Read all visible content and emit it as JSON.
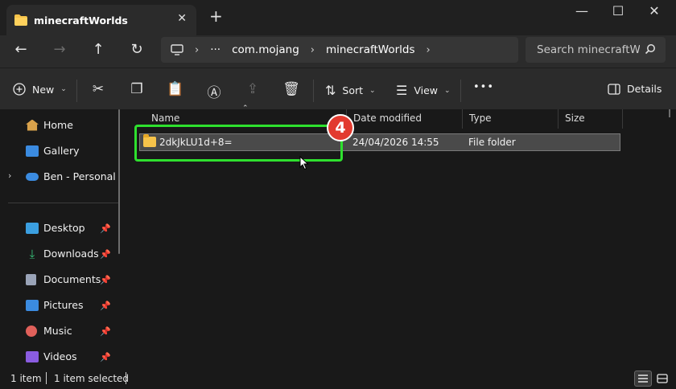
{
  "window": {
    "tab_title": "minecraftWorlds",
    "new_tab_symbol": "+",
    "close_tab_symbol": "✕",
    "minimize_symbol": "—",
    "maximize_symbol": "☐",
    "close_symbol": "✕"
  },
  "address": {
    "ellipsis": "···",
    "crumbs": [
      "com.mojang",
      "minecraftWorlds"
    ],
    "search_placeholder": "Search minecraftW"
  },
  "toolbar": {
    "new_label": "New",
    "sort_label": "Sort",
    "view_label": "View",
    "more_label": "•••",
    "details_label": "Details"
  },
  "sidebar": {
    "items": [
      {
        "label": "Home",
        "icon": "home-icon",
        "color": "#d9a24b"
      },
      {
        "label": "Gallery",
        "icon": "gallery-icon",
        "color": "#3b8be0"
      },
      {
        "label": "Ben - Personal",
        "icon": "onedrive-icon",
        "color": "#3b8be0"
      },
      {
        "label": "Desktop",
        "icon": "desktop-icon",
        "color": "#3b9fe0"
      },
      {
        "label": "Downloads",
        "icon": "downloads-icon",
        "color": "#37c27a"
      },
      {
        "label": "Documents",
        "icon": "documents-icon",
        "color": "#9aa4b8"
      },
      {
        "label": "Pictures",
        "icon": "pictures-icon",
        "color": "#3b8be0"
      },
      {
        "label": "Music",
        "icon": "music-icon",
        "color": "#e0605a"
      },
      {
        "label": "Videos",
        "icon": "videos-icon",
        "color": "#8a5ce0"
      }
    ],
    "pin_symbol": "📌"
  },
  "columns": {
    "name": "Name",
    "date": "Date modified",
    "type": "Type",
    "size": "Size"
  },
  "files": [
    {
      "name": "2dkJkLU1d+8=",
      "date": "24/04/2026 14:55",
      "type": "File folder",
      "size": ""
    }
  ],
  "annotation": {
    "step_number": "4",
    "highlight_color": "#2ee02e",
    "badge_color": "#e23a2f"
  },
  "status": {
    "item_count": "1 item",
    "selected": "1 item selected"
  }
}
